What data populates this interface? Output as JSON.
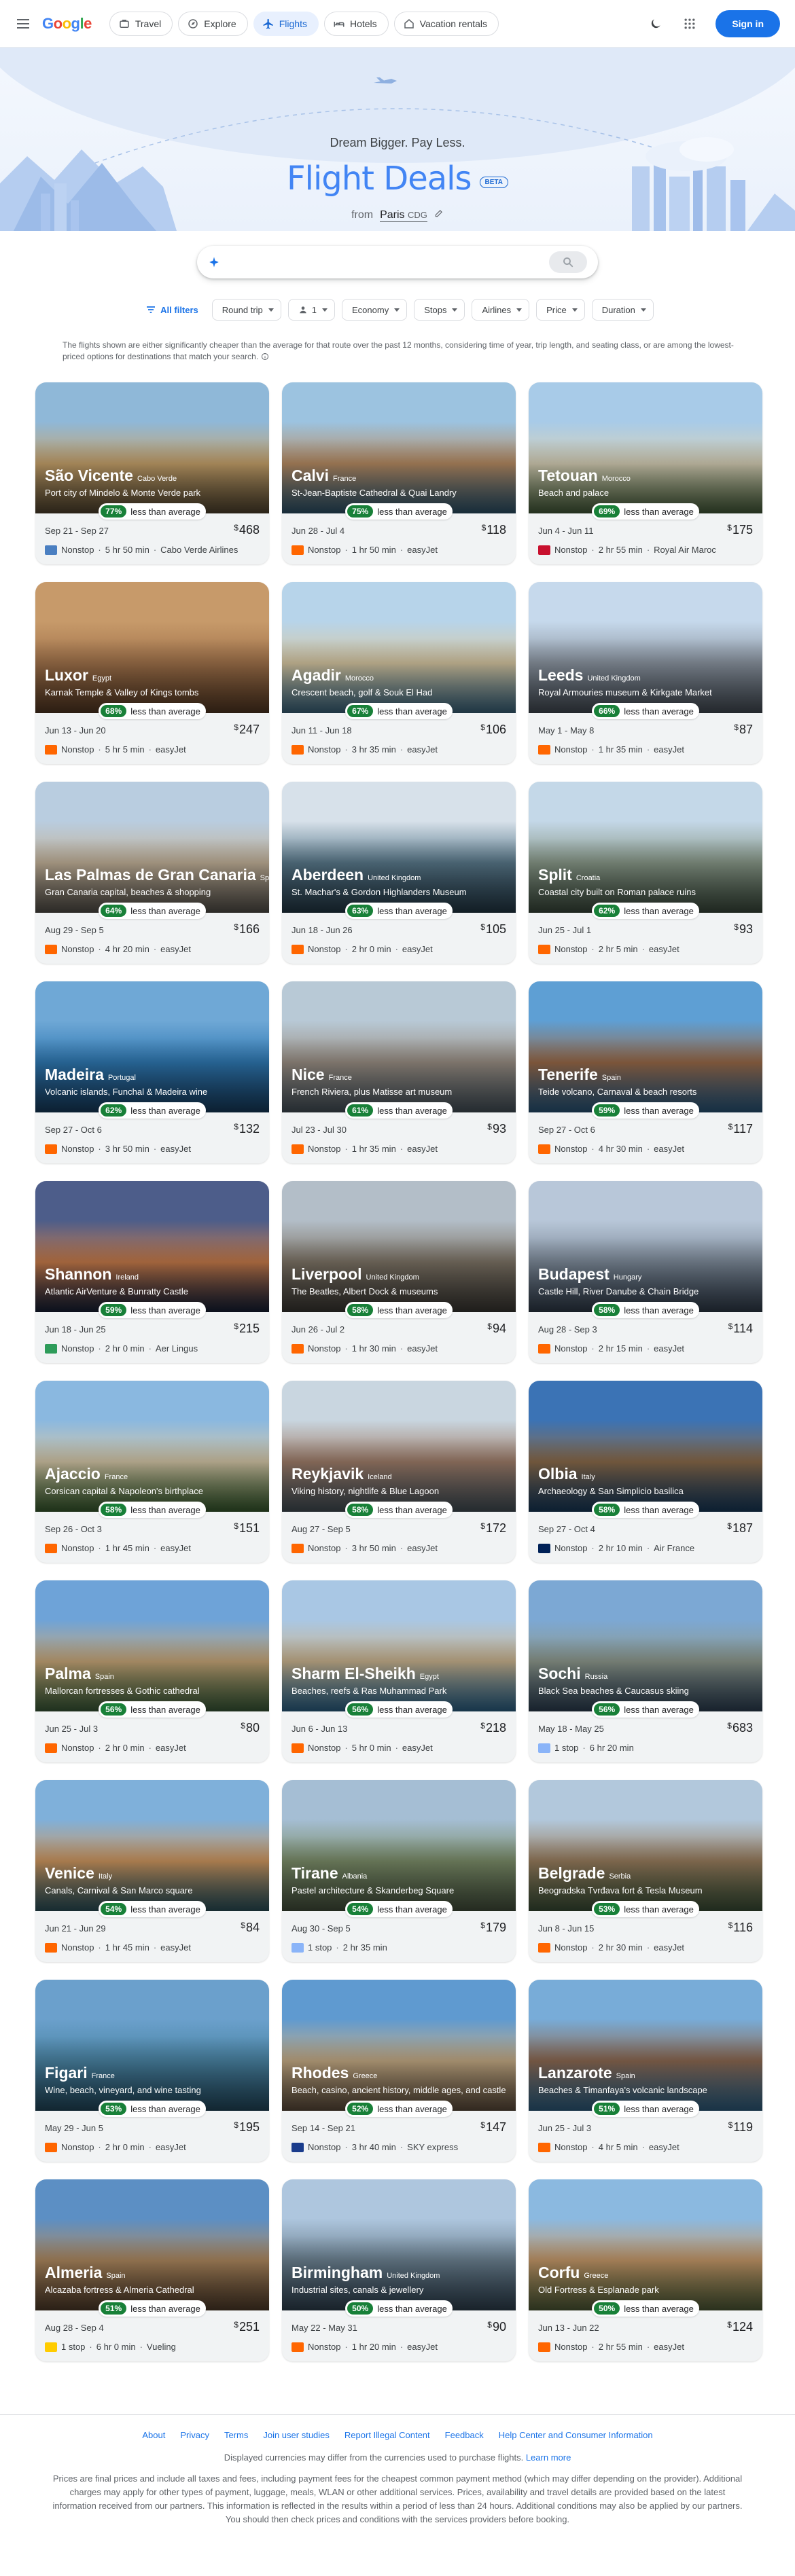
{
  "header": {
    "logo_letters": [
      "G",
      "o",
      "o",
      "g",
      "l",
      "e"
    ],
    "nav": [
      {
        "label": "Travel",
        "icon": "suitcase-icon"
      },
      {
        "label": "Explore",
        "icon": "explore-icon"
      },
      {
        "label": "Flights",
        "icon": "plane-icon",
        "active": true
      },
      {
        "label": "Hotels",
        "icon": "bed-icon"
      },
      {
        "label": "Vacation rentals",
        "icon": "house-icon"
      }
    ],
    "signin_label": "Sign in"
  },
  "hero": {
    "tagline": "Dream Bigger. Pay Less.",
    "title": "Flight Deals",
    "badge": "BETA",
    "from_label": "from",
    "from_city": "Paris",
    "from_code": "CDG"
  },
  "search": {
    "placeholder": ""
  },
  "filters": {
    "all_label": "All filters",
    "trip": "Round trip",
    "passengers": "1",
    "cabin": "Economy",
    "stops": "Stops",
    "airlines": "Airlines",
    "price": "Price",
    "duration": "Duration"
  },
  "disclaimer": "The flights shown are either significantly cheaper than the average for that route over the past 12 months, considering time of year, trip length, and seating class, or are among the lowest-priced options for destinations that match your search.",
  "less_than_average": "less than average",
  "currency": "$",
  "deals": [
    {
      "city": "São Vicente",
      "country": "Cabo Verde",
      "desc": "Port city of Mindelo & Monte Verde park",
      "pct": "77%",
      "dates": "Sep 21 - Sep 27",
      "price": "468",
      "stops": "Nonstop",
      "duration": "5 hr 50 min",
      "airline": "Cabo Verde Airlines",
      "img": [
        "#8fb8d8",
        "#c9a46c",
        "#6b5a3e"
      ],
      "logo": "#4a7fc1"
    },
    {
      "city": "Calvi",
      "country": "France",
      "desc": "St-Jean-Baptiste Cathedral & Quai Landry",
      "pct": "75%",
      "dates": "Jun 28 - Jul 4",
      "price": "118",
      "stops": "Nonstop",
      "duration": "1 hr 50 min",
      "airline": "easyJet",
      "img": [
        "#9cc3e0",
        "#b98d63",
        "#3d6f8e"
      ],
      "logo": "#ff6600"
    },
    {
      "city": "Tetouan",
      "country": "Morocco",
      "desc": "Beach and palace",
      "pct": "69%",
      "dates": "Jun 4 - Jun 11",
      "price": "175",
      "stops": "Nonstop",
      "duration": "2 hr 55 min",
      "airline": "Royal Air Maroc",
      "img": [
        "#a8cbe8",
        "#d9d2b8",
        "#5c7a4d"
      ],
      "logo": "#c8102e"
    },
    {
      "city": "Luxor",
      "country": "Egypt",
      "desc": "Karnak Temple & Valley of Kings tombs",
      "pct": "68%",
      "dates": "Jun 13 - Jun 20",
      "price": "247",
      "stops": "Nonstop",
      "duration": "5 hr 5 min",
      "airline": "easyJet",
      "img": [
        "#c79a6a",
        "#a3744c",
        "#6e4a2e"
      ],
      "logo": "#ff6600"
    },
    {
      "city": "Agadir",
      "country": "Morocco",
      "desc": "Crescent beach, golf & Souk El Had",
      "pct": "67%",
      "dates": "Jun 11 - Jun 18",
      "price": "106",
      "stops": "Nonstop",
      "duration": "3 hr 35 min",
      "airline": "easyJet",
      "img": [
        "#b7d4ea",
        "#d9c9a3",
        "#4f87a8"
      ],
      "logo": "#ff6600"
    },
    {
      "city": "Leeds",
      "country": "United Kingdom",
      "desc": "Royal Armouries museum & Kirkgate Market",
      "pct": "66%",
      "dates": "May 1 - May 8",
      "price": "87",
      "stops": "Nonstop",
      "duration": "1 hr 35 min",
      "airline": "easyJet",
      "img": [
        "#c6d9ec",
        "#8d97a3",
        "#5a6470"
      ],
      "logo": "#ff6600"
    },
    {
      "city": "Las Palmas de Gran Canaria",
      "country": "Spain",
      "desc": "Gran Canaria capital, beaches & shopping",
      "pct": "64%",
      "dates": "Aug 29 - Sep 5",
      "price": "166",
      "stops": "Nonstop",
      "duration": "4 hr 20 min",
      "airline": "easyJet",
      "img": [
        "#b9cde0",
        "#c4b39a",
        "#6f6a62"
      ],
      "logo": "#ff6600"
    },
    {
      "city": "Aberdeen",
      "country": "United Kingdom",
      "desc": "St. Machar's & Gordon Highlanders Museum",
      "pct": "63%",
      "dates": "Jun 18 - Jun 26",
      "price": "105",
      "stops": "Nonstop",
      "duration": "2 hr 0 min",
      "airline": "easyJet",
      "img": [
        "#d7e1ea",
        "#5a7a8c",
        "#2e4a5c"
      ],
      "logo": "#ff6600"
    },
    {
      "city": "Split",
      "country": "Croatia",
      "desc": "Coastal city built on Roman palace ruins",
      "pct": "62%",
      "dates": "Jun 25 - Jul 1",
      "price": "93",
      "stops": "Nonstop",
      "duration": "2 hr 5 min",
      "airline": "easyJet",
      "img": [
        "#c4d8e8",
        "#8a9a8a",
        "#4d6150"
      ],
      "logo": "#ff6600"
    },
    {
      "city": "Madeira",
      "country": "Portugal",
      "desc": "Volcanic islands, Funchal & Madeira wine",
      "pct": "62%",
      "dates": "Sep 27 - Oct 6",
      "price": "132",
      "stops": "Nonstop",
      "duration": "3 hr 50 min",
      "airline": "easyJet",
      "img": [
        "#6fa8d6",
        "#2f79b3",
        "#1d4f7c"
      ],
      "logo": "#ff6600"
    },
    {
      "city": "Nice",
      "country": "France",
      "desc": "French Riviera, plus Matisse art museum",
      "pct": "61%",
      "dates": "Jul 23 - Jul 30",
      "price": "93",
      "stops": "Nonstop",
      "duration": "1 hr 35 min",
      "airline": "easyJet",
      "img": [
        "#b8c9d6",
        "#9a8f84",
        "#5c6c78"
      ],
      "logo": "#ff6600"
    },
    {
      "city": "Tenerife",
      "country": "Spain",
      "desc": "Teide volcano, Carnaval & beach resorts",
      "pct": "59%",
      "dates": "Sep 27 - Oct 6",
      "price": "117",
      "stops": "Nonstop",
      "duration": "4 hr 30 min",
      "airline": "easyJet",
      "img": [
        "#5e9fd4",
        "#9a6a48",
        "#3674a6"
      ],
      "logo": "#ff6600"
    },
    {
      "city": "Shannon",
      "country": "Ireland",
      "desc": "Atlantic AirVenture & Bunratty Castle",
      "pct": "59%",
      "dates": "Jun 18 - Jun 25",
      "price": "215",
      "stops": "Nonstop",
      "duration": "2 hr 0 min",
      "airline": "Aer Lingus",
      "img": [
        "#4d5d8a",
        "#c77b4a",
        "#1e2a48"
      ],
      "logo": "#2e9c5a"
    },
    {
      "city": "Liverpool",
      "country": "United Kingdom",
      "desc": "The Beatles, Albert Dock & museums",
      "pct": "58%",
      "dates": "Jun 26 - Jul 2",
      "price": "94",
      "stops": "Nonstop",
      "duration": "1 hr 30 min",
      "airline": "easyJet",
      "img": [
        "#b3bec8",
        "#7e7466",
        "#4d4a44"
      ],
      "logo": "#ff6600"
    },
    {
      "city": "Budapest",
      "country": "Hungary",
      "desc": "Castle Hill, River Danube & Chain Bridge",
      "pct": "58%",
      "dates": "Aug 28 - Sep 3",
      "price": "114",
      "stops": "Nonstop",
      "duration": "2 hr 15 min",
      "airline": "easyJet",
      "img": [
        "#b8c7d9",
        "#7f8c9b",
        "#3f4f62"
      ],
      "logo": "#ff6600"
    },
    {
      "city": "Ajaccio",
      "country": "France",
      "desc": "Corsican capital & Napoleon's birthplace",
      "pct": "58%",
      "dates": "Sep 26 - Oct 3",
      "price": "151",
      "stops": "Nonstop",
      "duration": "1 hr 45 min",
      "airline": "easyJet",
      "img": [
        "#8ab8e0",
        "#d6c8a8",
        "#4a7a3e"
      ],
      "logo": "#ff6600"
    },
    {
      "city": "Reykjavik",
      "country": "Iceland",
      "desc": "Viking history, nightlife & Blue Lagoon",
      "pct": "58%",
      "dates": "Aug 27 - Sep 5",
      "price": "172",
      "stops": "Nonstop",
      "duration": "3 hr 50 min",
      "airline": "easyJet",
      "img": [
        "#c9d6e0",
        "#a07e6a",
        "#5b6a74"
      ],
      "logo": "#ff6600"
    },
    {
      "city": "Olbia",
      "country": "Italy",
      "desc": "Archaeology & San Simplicio basilica",
      "pct": "58%",
      "dates": "Sep 27 - Oct 4",
      "price": "187",
      "stops": "Nonstop",
      "duration": "2 hr 10 min",
      "airline": "Air France",
      "img": [
        "#3b73b5",
        "#8b6b4a",
        "#1f4d7a"
      ],
      "logo": "#002157"
    },
    {
      "city": "Palma",
      "country": "Spain",
      "desc": "Mallorcan fortresses & Gothic cathedral",
      "pct": "56%",
      "dates": "Jun 25 - Jul 3",
      "price": "80",
      "stops": "Nonstop",
      "duration": "2 hr 0 min",
      "airline": "easyJet",
      "img": [
        "#6ea3d8",
        "#c9a879",
        "#4e7a4c"
      ],
      "logo": "#ff6600"
    },
    {
      "city": "Sharm El-Sheikh",
      "country": "Egypt",
      "desc": "Beaches, reefs & Ras Muhammad Park",
      "pct": "56%",
      "dates": "Jun 6 - Jun 13",
      "price": "218",
      "stops": "Nonstop",
      "duration": "5 hr 0 min",
      "airline": "easyJet",
      "img": [
        "#a9c7e4",
        "#cbb48f",
        "#3b86b8"
      ],
      "logo": "#ff6600"
    },
    {
      "city": "Sochi",
      "country": "Russia",
      "desc": "Black Sea beaches & Caucasus skiing",
      "pct": "56%",
      "dates": "May 18 - May 25",
      "price": "683",
      "stops": "1 stop",
      "duration": "6 hr 20 min",
      "airline": "",
      "img": [
        "#7ca8d4",
        "#8f9a8e",
        "#3d5670"
      ],
      "logo": "#8ab4f8"
    },
    {
      "city": "Venice",
      "country": "Italy",
      "desc": "Canals, Carnival & San Marco square",
      "pct": "54%",
      "dates": "Jun 21 - Jun 29",
      "price": "84",
      "stops": "Nonstop",
      "duration": "1 hr 45 min",
      "airline": "easyJet",
      "img": [
        "#7fb0da",
        "#d09860",
        "#3a6d7a"
      ],
      "logo": "#ff6600"
    },
    {
      "city": "Tirane",
      "country": "Albania",
      "desc": "Pastel architecture & Skanderbeg Square",
      "pct": "54%",
      "dates": "Aug 30 - Sep 5",
      "price": "179",
      "stops": "1 stop",
      "duration": "2 hr 35 min",
      "airline": "",
      "img": [
        "#a5bed4",
        "#7d8f6a",
        "#5a6a50"
      ],
      "logo": "#8ab4f8"
    },
    {
      "city": "Belgrade",
      "country": "Serbia",
      "desc": "Beogradska Tvrđava fort & Tesla Museum",
      "pct": "53%",
      "dates": "Jun 8 - Jun 15",
      "price": "116",
      "stops": "Nonstop",
      "duration": "2 hr 30 min",
      "airline": "easyJet",
      "img": [
        "#b2c8dc",
        "#9a7e5e",
        "#4e6a4a"
      ],
      "logo": "#ff6600"
    },
    {
      "city": "Figari",
      "country": "France",
      "desc": "Wine, beach, vineyard, and wine tasting",
      "pct": "53%",
      "dates": "May 29 - Jun 5",
      "price": "195",
      "stops": "Nonstop",
      "duration": "2 hr 0 min",
      "airline": "easyJet",
      "img": [
        "#6ba0cc",
        "#4b86a6",
        "#2d5f7a"
      ],
      "logo": "#ff6600"
    },
    {
      "city": "Rhodes",
      "country": "Greece",
      "desc": "Beach, casino, ancient history, middle ages, and castle",
      "pct": "52%",
      "dates": "Sep 14 - Sep 21",
      "price": "147",
      "stops": "Nonstop",
      "duration": "3 hr 40 min",
      "airline": "SKY express",
      "img": [
        "#5f9ad0",
        "#c7ad86",
        "#7b6650"
      ],
      "logo": "#1a3c8c"
    },
    {
      "city": "Lanzarote",
      "country": "Spain",
      "desc": "Beaches & Timanfaya's volcanic landscape",
      "pct": "51%",
      "dates": "Jun 25 - Jul 3",
      "price": "119",
      "stops": "Nonstop",
      "duration": "4 hr 5 min",
      "airline": "easyJet",
      "img": [
        "#78acd8",
        "#8e6a52",
        "#3e7fad"
      ],
      "logo": "#ff6600"
    },
    {
      "city": "Almeria",
      "country": "Spain",
      "desc": "Alcazaba fortress & Almeria Cathedral",
      "pct": "51%",
      "dates": "Aug 28 - Sep 4",
      "price": "251",
      "stops": "1 stop",
      "duration": "6 hr 0 min",
      "airline": "Vueling",
      "img": [
        "#5c8fc4",
        "#b08a60",
        "#6a5038"
      ],
      "logo": "#ffcc00"
    },
    {
      "city": "Birmingham",
      "country": "United Kingdom",
      "desc": "Industrial sites, canals & jewellery",
      "pct": "50%",
      "dates": "May 22 - May 31",
      "price": "90",
      "stops": "Nonstop",
      "duration": "1 hr 20 min",
      "airline": "easyJet",
      "img": [
        "#aec6de",
        "#6e8494",
        "#3e566a"
      ],
      "logo": "#ff6600"
    },
    {
      "city": "Corfu",
      "country": "Greece",
      "desc": "Old Fortress & Esplanade park",
      "pct": "50%",
      "dates": "Jun 13 - Jun 22",
      "price": "124",
      "stops": "Nonstop",
      "duration": "2 hr 55 min",
      "airline": "easyJet",
      "img": [
        "#8bb9e0",
        "#c89a6a",
        "#6a7a4a"
      ],
      "logo": "#ff6600"
    }
  ],
  "footer": {
    "links": [
      "About",
      "Privacy",
      "Terms",
      "Join user studies",
      "Report Illegal Content",
      "Feedback",
      "Help Center and Consumer Information"
    ],
    "currency_note": "Displayed currencies may differ from the currencies used to purchase flights.",
    "learn_more": "Learn more",
    "legal": "Prices are final prices and include all taxes and fees, including payment fees for the cheapest common payment method (which may differ depending on the provider). Additional charges may apply for other types of payment, luggage, meals, WLAN or other additional services. Prices, availability and travel details are provided based on the latest information received from our partners. This information is reflected in the results within a period of less than 24 hours. Additional conditions may also be applied by our partners. You should then check prices and conditions with the services providers before booking."
  },
  "colors": {
    "accent": "#1a73e8",
    "green_badge": "#188038",
    "title_blue": "#4285f4"
  }
}
